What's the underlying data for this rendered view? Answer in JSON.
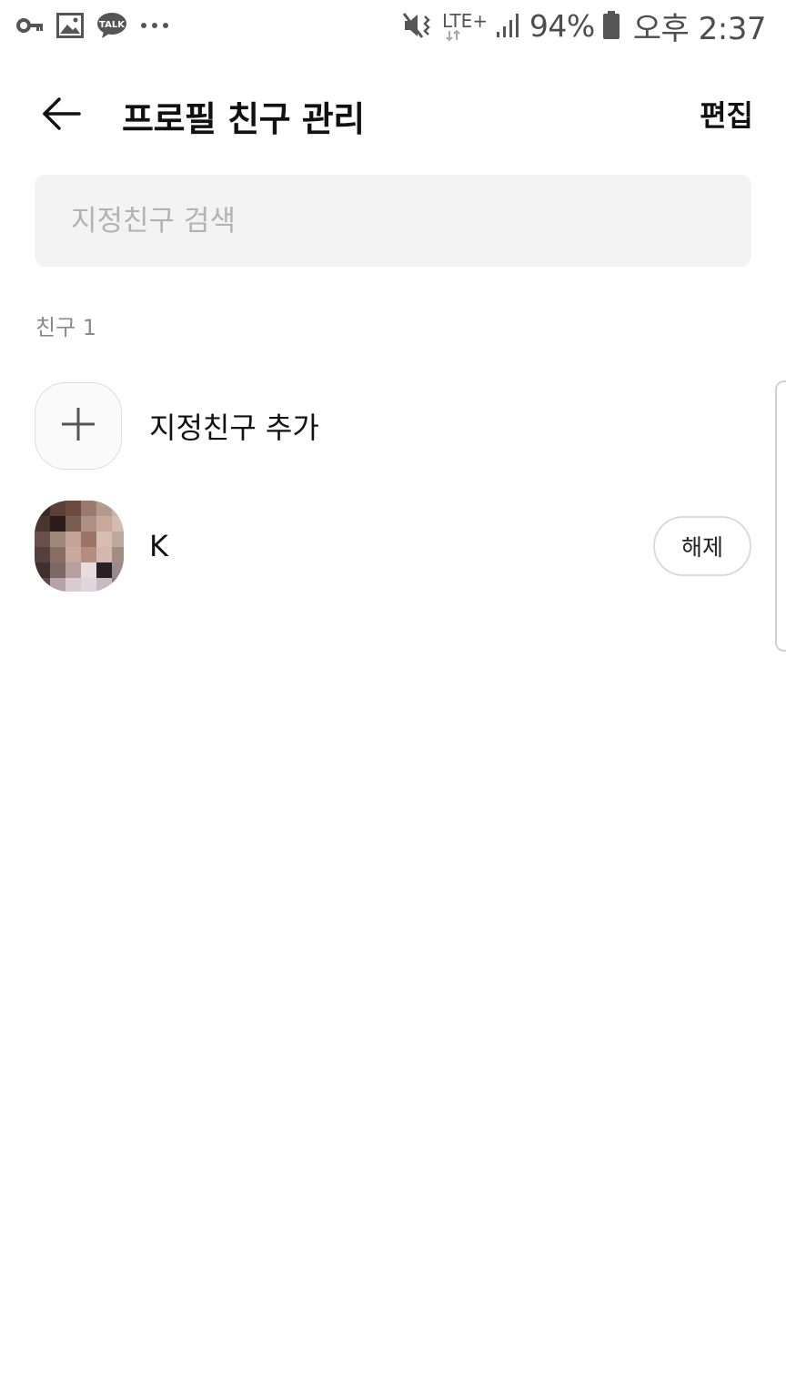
{
  "status_bar": {
    "left_icons": [
      "key-icon",
      "gallery-icon",
      "kakaotalk-icon",
      "more-dots-icon"
    ],
    "talk_badge": "TALK",
    "right_icons": [
      "mute-vibrate-icon",
      "lte-plus-icon",
      "signal-icon",
      "battery-icon"
    ],
    "network": "LTE+",
    "battery_percent": "94%",
    "time": "오후 2:37"
  },
  "header": {
    "back_icon": "back-arrow-icon",
    "title": "프로필 친구 관리",
    "edit_label": "편집"
  },
  "search": {
    "placeholder": "지정친구 검색",
    "value": ""
  },
  "friends_section": {
    "label": "친구 1"
  },
  "add_friend": {
    "icon": "plus-icon",
    "label": "지정친구 추가"
  },
  "friends": [
    {
      "name": "K",
      "avatar": "pixelated-avatar",
      "action_label": "해제"
    }
  ],
  "colors": {
    "background": "#ffffff",
    "search_bg": "#f3f3f3",
    "placeholder": "#b3b3b3",
    "section_label": "#8a8a8a",
    "text": "#111111"
  }
}
